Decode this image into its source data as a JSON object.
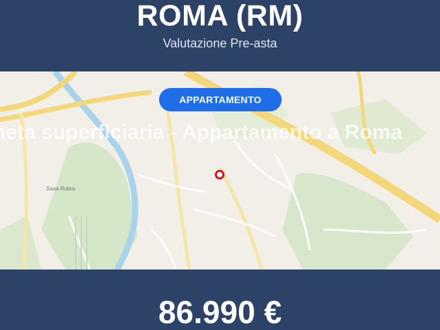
{
  "header": {
    "city": "ROMA (RM)",
    "subtitle": "Valutazione Pre-asta"
  },
  "map": {
    "badge": "APPARTAMENTO",
    "watermark": "neta superficiaria - Appartamento a Roma",
    "place_label": "Saxa Rubra"
  },
  "footer": {
    "price": "86.990 €"
  },
  "colors": {
    "banner": "#2c4267",
    "badge": "#1f6ee8",
    "pin": "#d0162e"
  }
}
